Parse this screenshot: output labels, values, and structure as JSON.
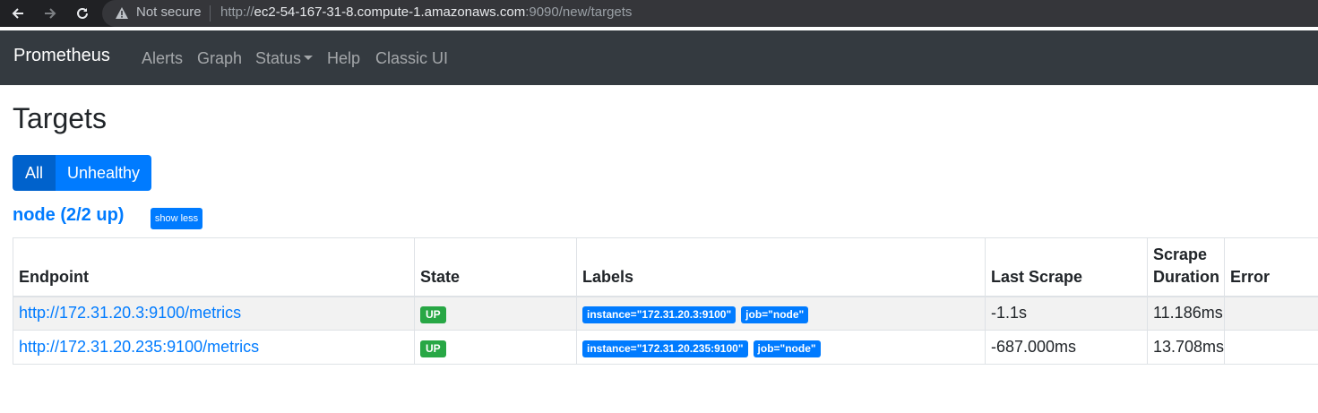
{
  "browser": {
    "not_secure": "Not secure",
    "url_prefix": "http://",
    "url_host": "ec2-54-167-31-8.compute-1.amazonaws.com",
    "url_rest": ":9090/new/targets"
  },
  "navbar": {
    "brand": "Prometheus",
    "links": [
      "Alerts",
      "Graph",
      "Status",
      "Help",
      "Classic UI"
    ]
  },
  "page": {
    "title": "Targets"
  },
  "filters": {
    "all": "All",
    "unhealthy": "Unhealthy"
  },
  "pool": {
    "title": "node (2/2 up)",
    "toggle": "show less"
  },
  "table": {
    "headers": [
      "Endpoint",
      "State",
      "Labels",
      "Last Scrape",
      "Scrape Duration",
      "Error"
    ],
    "rows": [
      {
        "endpoint": "http://172.31.20.3:9100/metrics",
        "state": "UP",
        "labels": [
          "instance=\"172.31.20.3:9100\"",
          "job=\"node\""
        ],
        "last_scrape": "-1.1s",
        "duration": "11.186ms",
        "error": ""
      },
      {
        "endpoint": "http://172.31.20.235:9100/metrics",
        "state": "UP",
        "labels": [
          "instance=\"172.31.20.235:9100\"",
          "job=\"node\""
        ],
        "last_scrape": "-687.000ms",
        "duration": "13.708ms",
        "error": ""
      }
    ]
  },
  "colors": {
    "primary": "#007bff",
    "success": "#28a745",
    "navbar": "#343a40"
  }
}
